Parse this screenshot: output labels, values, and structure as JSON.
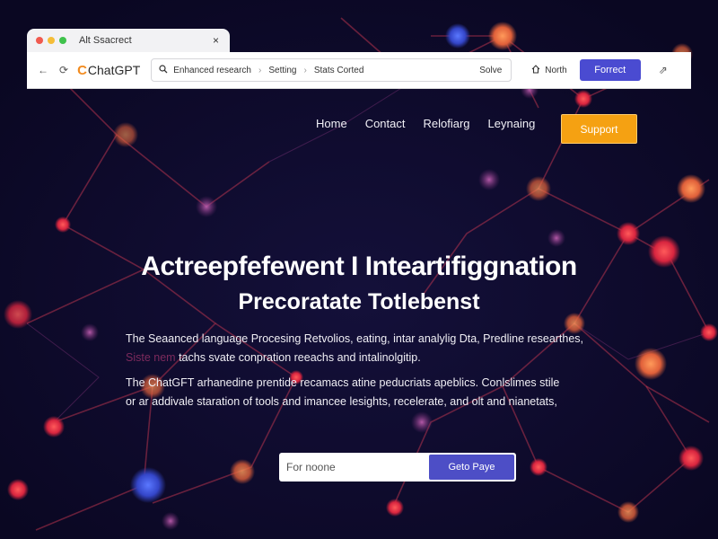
{
  "browser": {
    "tab_title": "Alt Ssacrect",
    "tab_close": "×",
    "traffic_colors": [
      "#f05a4f",
      "#f5bd38",
      "#3fc24c"
    ],
    "back_glyph": "←",
    "reload_glyph": "⟳",
    "brand_prefix": "C",
    "brand_name": "ChatGPT",
    "address_segments": [
      "Enhanced research",
      "Setting",
      "Stats Corted"
    ],
    "address_separator": "›",
    "address_right": "Solve",
    "north_label": "North",
    "toolbar_button": "Forrect",
    "share_glyph": "⇗"
  },
  "site_nav": {
    "items": [
      "Home",
      "Contact",
      "Relofiarg",
      "Leynaing"
    ],
    "support_button": "Support"
  },
  "hero": {
    "title": "Actreepfefewent I Inteartifiggnation",
    "subtitle": "Precoratate Totlebenst",
    "para1_line1": "The Seaanced language Procesing Retvolios, eating, intar analylig Dta, Predline researthes,",
    "para1_dim": "Siste nem",
    "para1_line2": "tachs svate conpration reeachs and intalinolgitip.",
    "para2_line1": "The ChatGFT arhanedine prentide recamacs atine peducriats apeblics. Conlslimes stile",
    "para2_line2": "or ar addivale staration of tools and imancee lesights, recelerate, and olt and nianetats,"
  },
  "form": {
    "placeholder": "For noone",
    "button": "Geto Paye"
  },
  "colors": {
    "accent": "#4a4bd1",
    "support": "#f5a112",
    "background": "#0f0b2a"
  }
}
